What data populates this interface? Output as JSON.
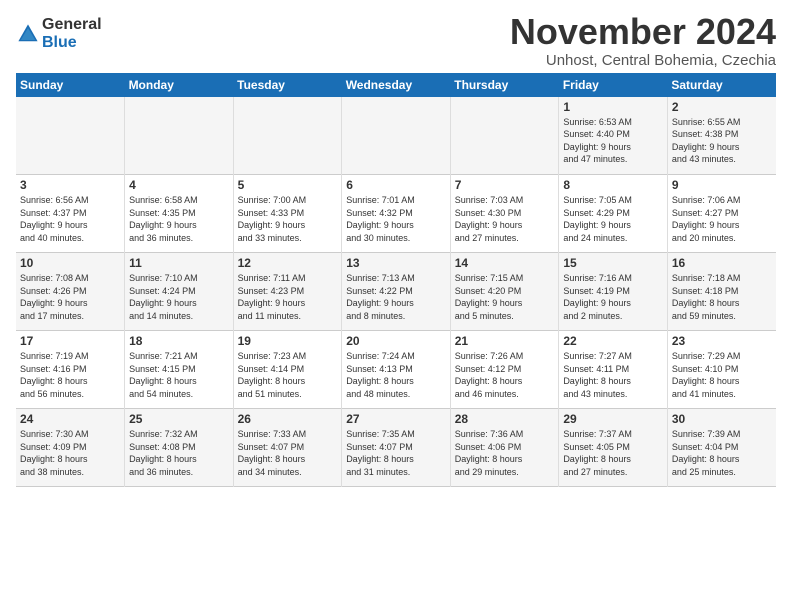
{
  "header": {
    "logo_line1": "General",
    "logo_line2": "Blue",
    "month": "November 2024",
    "location": "Unhost, Central Bohemia, Czechia"
  },
  "weekdays": [
    "Sunday",
    "Monday",
    "Tuesday",
    "Wednesday",
    "Thursday",
    "Friday",
    "Saturday"
  ],
  "weeks": [
    [
      {
        "day": "",
        "info": ""
      },
      {
        "day": "",
        "info": ""
      },
      {
        "day": "",
        "info": ""
      },
      {
        "day": "",
        "info": ""
      },
      {
        "day": "",
        "info": ""
      },
      {
        "day": "1",
        "info": "Sunrise: 6:53 AM\nSunset: 4:40 PM\nDaylight: 9 hours\nand 47 minutes."
      },
      {
        "day": "2",
        "info": "Sunrise: 6:55 AM\nSunset: 4:38 PM\nDaylight: 9 hours\nand 43 minutes."
      }
    ],
    [
      {
        "day": "3",
        "info": "Sunrise: 6:56 AM\nSunset: 4:37 PM\nDaylight: 9 hours\nand 40 minutes."
      },
      {
        "day": "4",
        "info": "Sunrise: 6:58 AM\nSunset: 4:35 PM\nDaylight: 9 hours\nand 36 minutes."
      },
      {
        "day": "5",
        "info": "Sunrise: 7:00 AM\nSunset: 4:33 PM\nDaylight: 9 hours\nand 33 minutes."
      },
      {
        "day": "6",
        "info": "Sunrise: 7:01 AM\nSunset: 4:32 PM\nDaylight: 9 hours\nand 30 minutes."
      },
      {
        "day": "7",
        "info": "Sunrise: 7:03 AM\nSunset: 4:30 PM\nDaylight: 9 hours\nand 27 minutes."
      },
      {
        "day": "8",
        "info": "Sunrise: 7:05 AM\nSunset: 4:29 PM\nDaylight: 9 hours\nand 24 minutes."
      },
      {
        "day": "9",
        "info": "Sunrise: 7:06 AM\nSunset: 4:27 PM\nDaylight: 9 hours\nand 20 minutes."
      }
    ],
    [
      {
        "day": "10",
        "info": "Sunrise: 7:08 AM\nSunset: 4:26 PM\nDaylight: 9 hours\nand 17 minutes."
      },
      {
        "day": "11",
        "info": "Sunrise: 7:10 AM\nSunset: 4:24 PM\nDaylight: 9 hours\nand 14 minutes."
      },
      {
        "day": "12",
        "info": "Sunrise: 7:11 AM\nSunset: 4:23 PM\nDaylight: 9 hours\nand 11 minutes."
      },
      {
        "day": "13",
        "info": "Sunrise: 7:13 AM\nSunset: 4:22 PM\nDaylight: 9 hours\nand 8 minutes."
      },
      {
        "day": "14",
        "info": "Sunrise: 7:15 AM\nSunset: 4:20 PM\nDaylight: 9 hours\nand 5 minutes."
      },
      {
        "day": "15",
        "info": "Sunrise: 7:16 AM\nSunset: 4:19 PM\nDaylight: 9 hours\nand 2 minutes."
      },
      {
        "day": "16",
        "info": "Sunrise: 7:18 AM\nSunset: 4:18 PM\nDaylight: 8 hours\nand 59 minutes."
      }
    ],
    [
      {
        "day": "17",
        "info": "Sunrise: 7:19 AM\nSunset: 4:16 PM\nDaylight: 8 hours\nand 56 minutes."
      },
      {
        "day": "18",
        "info": "Sunrise: 7:21 AM\nSunset: 4:15 PM\nDaylight: 8 hours\nand 54 minutes."
      },
      {
        "day": "19",
        "info": "Sunrise: 7:23 AM\nSunset: 4:14 PM\nDaylight: 8 hours\nand 51 minutes."
      },
      {
        "day": "20",
        "info": "Sunrise: 7:24 AM\nSunset: 4:13 PM\nDaylight: 8 hours\nand 48 minutes."
      },
      {
        "day": "21",
        "info": "Sunrise: 7:26 AM\nSunset: 4:12 PM\nDaylight: 8 hours\nand 46 minutes."
      },
      {
        "day": "22",
        "info": "Sunrise: 7:27 AM\nSunset: 4:11 PM\nDaylight: 8 hours\nand 43 minutes."
      },
      {
        "day": "23",
        "info": "Sunrise: 7:29 AM\nSunset: 4:10 PM\nDaylight: 8 hours\nand 41 minutes."
      }
    ],
    [
      {
        "day": "24",
        "info": "Sunrise: 7:30 AM\nSunset: 4:09 PM\nDaylight: 8 hours\nand 38 minutes."
      },
      {
        "day": "25",
        "info": "Sunrise: 7:32 AM\nSunset: 4:08 PM\nDaylight: 8 hours\nand 36 minutes."
      },
      {
        "day": "26",
        "info": "Sunrise: 7:33 AM\nSunset: 4:07 PM\nDaylight: 8 hours\nand 34 minutes."
      },
      {
        "day": "27",
        "info": "Sunrise: 7:35 AM\nSunset: 4:07 PM\nDaylight: 8 hours\nand 31 minutes."
      },
      {
        "day": "28",
        "info": "Sunrise: 7:36 AM\nSunset: 4:06 PM\nDaylight: 8 hours\nand 29 minutes."
      },
      {
        "day": "29",
        "info": "Sunrise: 7:37 AM\nSunset: 4:05 PM\nDaylight: 8 hours\nand 27 minutes."
      },
      {
        "day": "30",
        "info": "Sunrise: 7:39 AM\nSunset: 4:04 PM\nDaylight: 8 hours\nand 25 minutes."
      }
    ]
  ]
}
